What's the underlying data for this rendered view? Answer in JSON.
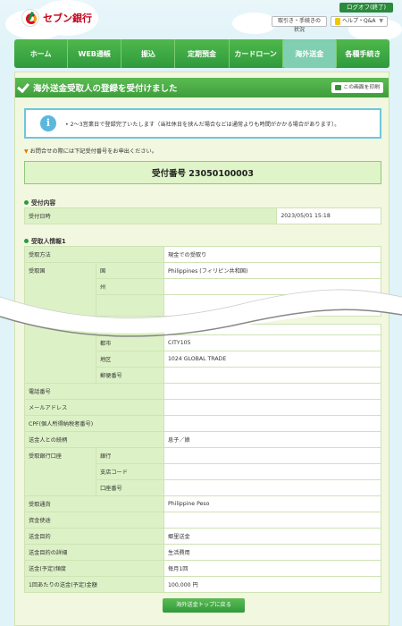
{
  "header": {
    "logout": "ログオフ(終了)",
    "bank_name": "セブン銀行",
    "status_button": "取引き・手続きの状況",
    "help_button": "ヘルプ・Q&A"
  },
  "nav": [
    {
      "label": "ホーム"
    },
    {
      "label": "WEB通帳"
    },
    {
      "label": "振込"
    },
    {
      "label": "定期預金"
    },
    {
      "label": "カードローン"
    },
    {
      "label": "海外送金"
    },
    {
      "label": "各種手続き"
    }
  ],
  "page": {
    "title": "海外送金受取人の登録を受付けました",
    "print_button": "この画面を印刷",
    "info": "2～3営業日で登録完了いたします（当社休日を挟んだ場合などは通常よりも時間がかかる場合があります）。",
    "note": "お問合せの際には下記受付番号をお申出ください。",
    "receipt": "受付番号 23050100003"
  },
  "reception": {
    "heading": "受付内容",
    "date_label": "受付日時",
    "date_value": "2023/05/01 15:18"
  },
  "recipient": {
    "heading": "受取人情報1",
    "method_label": "受取方法",
    "method_value": "現金での受取り",
    "country_label": "受取国",
    "country_sub": "国",
    "country_value": "Philippines (フィリピン共和国)",
    "state_sub": "州",
    "city_sub": "都市",
    "city_value": "CITY105",
    "area_sub": "地区",
    "area_value": "1024 GLOBAL TRADE",
    "postal_sub": "郵便番号",
    "phone_label": "電話番号",
    "email_label": "メールアドレス",
    "cpf_label": "CPF(個人所得納税者番号)",
    "relation_label": "送金人との続柄",
    "relation_value": "息子／娘",
    "bank_label": "受取銀行口座",
    "bank_sub": "銀行",
    "branch_sub": "支店コード",
    "account_sub": "口座番号",
    "currency_label": "受取通貨",
    "currency_value": "Philippine Peso",
    "purpose_label": "資金使途",
    "remit_purpose_label": "送金目的",
    "remit_purpose_value": "郷里送金",
    "remit_detail_label": "送金目的の詳細",
    "remit_detail_value": "生活費用",
    "frequency_label": "送金(予定)頻度",
    "frequency_value": "毎月1回",
    "amount_label": "1回あたりの送金(予定)金額",
    "amount_value": "100,000 円"
  },
  "footer": {
    "back_button": "海外送金トップに戻る"
  }
}
